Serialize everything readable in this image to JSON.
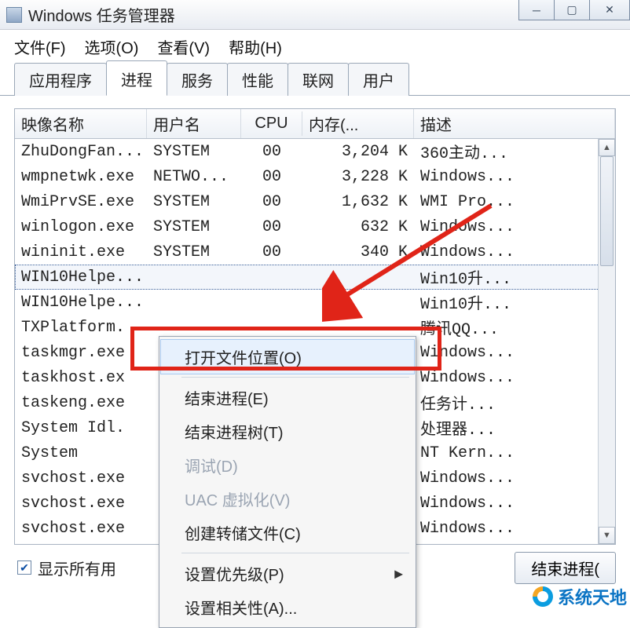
{
  "window": {
    "title": "Windows 任务管理器"
  },
  "menu": {
    "file": "文件(F)",
    "options": "选项(O)",
    "view": "查看(V)",
    "help": "帮助(H)"
  },
  "tabs": {
    "apps": "应用程序",
    "processes": "进程",
    "services": "服务",
    "performance": "性能",
    "networking": "联网",
    "users": "用户"
  },
  "columns": {
    "image": "映像名称",
    "user": "用户名",
    "cpu": "CPU",
    "memory": "内存(...",
    "description": "描述"
  },
  "rows": [
    {
      "img": "ZhuDongFan...",
      "user": "SYSTEM",
      "cpu": "00",
      "mem": "3,204 K",
      "desc": "360主动..."
    },
    {
      "img": "wmpnetwk.exe",
      "user": "NETWO...",
      "cpu": "00",
      "mem": "3,228 K",
      "desc": "Windows..."
    },
    {
      "img": "WmiPrvSE.exe",
      "user": "SYSTEM",
      "cpu": "00",
      "mem": "1,632 K",
      "desc": "WMI Pro..."
    },
    {
      "img": "winlogon.exe",
      "user": "SYSTEM",
      "cpu": "00",
      "mem": "632 K",
      "desc": "Windows..."
    },
    {
      "img": "wininit.exe",
      "user": "SYSTEM",
      "cpu": "00",
      "mem": "340 K",
      "desc": "Windows..."
    },
    {
      "img": "WIN10Helpe...",
      "user": "",
      "cpu": "",
      "mem": "",
      "desc": "Win10升..."
    },
    {
      "img": "WIN10Helpe...",
      "user": "",
      "cpu": "",
      "mem": "",
      "desc": "Win10升..."
    },
    {
      "img": "TXPlatform.",
      "user": "",
      "cpu": "",
      "mem": "",
      "desc": "腾讯QQ..."
    },
    {
      "img": "taskmgr.exe",
      "user": "",
      "cpu": "",
      "mem": "",
      "desc": "Windows..."
    },
    {
      "img": "taskhost.ex",
      "user": "",
      "cpu": "",
      "mem": "",
      "desc": "Windows..."
    },
    {
      "img": "taskeng.exe",
      "user": "",
      "cpu": "",
      "mem": "",
      "desc": "任务计..."
    },
    {
      "img": "System Idl.",
      "user": "",
      "cpu": "",
      "mem": "",
      "desc": "处理器..."
    },
    {
      "img": "System",
      "user": "",
      "cpu": "",
      "mem": "",
      "desc": "NT Kern..."
    },
    {
      "img": "svchost.exe",
      "user": "",
      "cpu": "",
      "mem": "",
      "desc": "Windows..."
    },
    {
      "img": "svchost.exe",
      "user": "",
      "cpu": "",
      "mem": "",
      "desc": "Windows..."
    },
    {
      "img": "svchost.exe",
      "user": "",
      "cpu": "",
      "mem": "",
      "desc": "Windows..."
    }
  ],
  "selected_row_index": 5,
  "context_menu": {
    "open_location": "打开文件位置(O)",
    "end_process": "结束进程(E)",
    "end_tree": "结束进程树(T)",
    "debug": "调试(D)",
    "uac": "UAC 虚拟化(V)",
    "create_dump": "创建转储文件(C)",
    "set_priority": "设置优先级(P)",
    "set_affinity": "设置相关性(A)..."
  },
  "footer": {
    "show_all": "显示所有用",
    "end_process_btn": "结束进程("
  },
  "watermark": "系统天地"
}
